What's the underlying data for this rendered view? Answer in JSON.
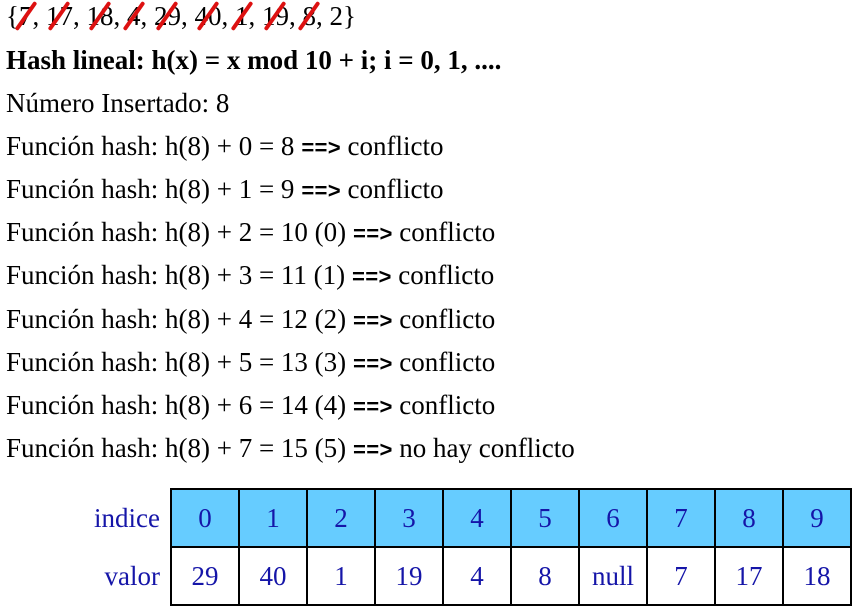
{
  "set": {
    "open": "{",
    "close": "}",
    "items": [
      {
        "value": "7",
        "crossed": true
      },
      {
        "value": "17",
        "crossed": true
      },
      {
        "value": "18",
        "crossed": true
      },
      {
        "value": "4",
        "crossed": true
      },
      {
        "value": "29",
        "crossed": true
      },
      {
        "value": "40",
        "crossed": true
      },
      {
        "value": "1",
        "crossed": true
      },
      {
        "value": "19",
        "crossed": true
      },
      {
        "value": "8",
        "crossed": true
      },
      {
        "value": "2",
        "crossed": false
      }
    ],
    "separator": ", "
  },
  "title": "Hash lineal: h(x) = x mod 10 + i;    i = 0, 1, ....",
  "inserted_label": "Número Insertado:  8",
  "arrow": "==>",
  "steps": [
    {
      "expr": "Función hash: h(8) + 0 = 8",
      "result": "conflicto"
    },
    {
      "expr": "Función hash: h(8) + 1 = 9",
      "result": "conflicto"
    },
    {
      "expr": "Función hash: h(8) + 2 = 10 (0)",
      "result": "conflicto"
    },
    {
      "expr": "Función hash: h(8) + 3 = 11 (1)",
      "result": "conflicto"
    },
    {
      "expr": "Función hash: h(8) + 4 = 12 (2)",
      "result": "conflicto"
    },
    {
      "expr": "Función hash: h(8) + 5 = 13 (3)",
      "result": "conflicto"
    },
    {
      "expr": "Función hash: h(8) + 6 = 14 (4)",
      "result": "conflicto"
    },
    {
      "expr": "Función hash: h(8) + 7 = 15 (5)",
      "result": "no hay conflicto"
    }
  ],
  "table": {
    "index_label": "indice",
    "value_label": "valor",
    "indices": [
      "0",
      "1",
      "2",
      "3",
      "4",
      "5",
      "6",
      "7",
      "8",
      "9"
    ],
    "values": [
      "29",
      "40",
      "1",
      "19",
      "4",
      "8",
      "null",
      "7",
      "17",
      "18"
    ],
    "colors": {
      "index_bg": "#66ccff",
      "text": "#1515a8",
      "cross": "#dd1111"
    }
  }
}
